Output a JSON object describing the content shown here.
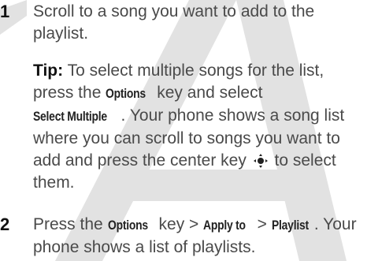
{
  "steps": [
    {
      "number": "1",
      "text_a": "Scroll to a song you want to add to the",
      "text_b": "playlist.",
      "tip": {
        "label": "Tip:",
        "line1": "To select multiple songs for the list,",
        "line2_pre": "press the",
        "line2_key": "Options",
        "line2_post": "key and select",
        "line3_key": "Select Multiple",
        "line3_post": ". Your phone shows a song list",
        "line4": "where you can scroll to songs you want to",
        "line5_pre": "add and press the center key",
        "line5_post": "to select",
        "line6": "them."
      }
    },
    {
      "number": "2",
      "line1_pre": "Press the",
      "options_key": "Options",
      "line1_mid": "key >",
      "apply_key": "Apply to",
      "sep": ">",
      "playlist_key": "Playlist",
      "line1_post": ". Your",
      "line2": "phone shows a list of playlists."
    }
  ],
  "icons": {
    "center_key": "nav-center-key-icon"
  },
  "watermark": {
    "color": "#d4d4d4"
  }
}
